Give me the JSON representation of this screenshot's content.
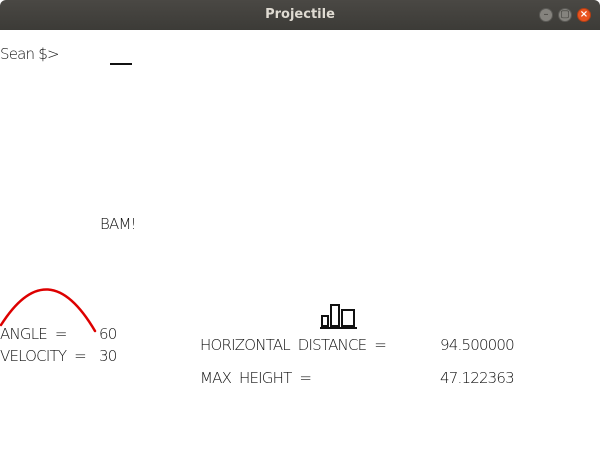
{
  "window": {
    "title": "Projectile",
    "buttons": {
      "minimize": "–",
      "maximize": "▢",
      "close": "×"
    }
  },
  "prompt": {
    "text": "Sean $>"
  },
  "message": {
    "text": "BAM!"
  },
  "inputs": {
    "angle_label": "ANGLE  =",
    "angle_value": "60",
    "velocity_label": "VELOCITY  =",
    "velocity_value": "30"
  },
  "results": {
    "horizontal_label": "HORIZONTAL  DISTANCE  =",
    "horizontal_value": "94.500000",
    "max_height_label": "MAX  HEIGHT  =",
    "max_height_value": "47.122363"
  },
  "colors": {
    "trajectory": "#dd0000",
    "text": "#111111"
  },
  "icons": {
    "window_controls": [
      "minimize-icon",
      "maximize-icon",
      "close-icon"
    ],
    "results_icon": "bar-chart-icon"
  }
}
